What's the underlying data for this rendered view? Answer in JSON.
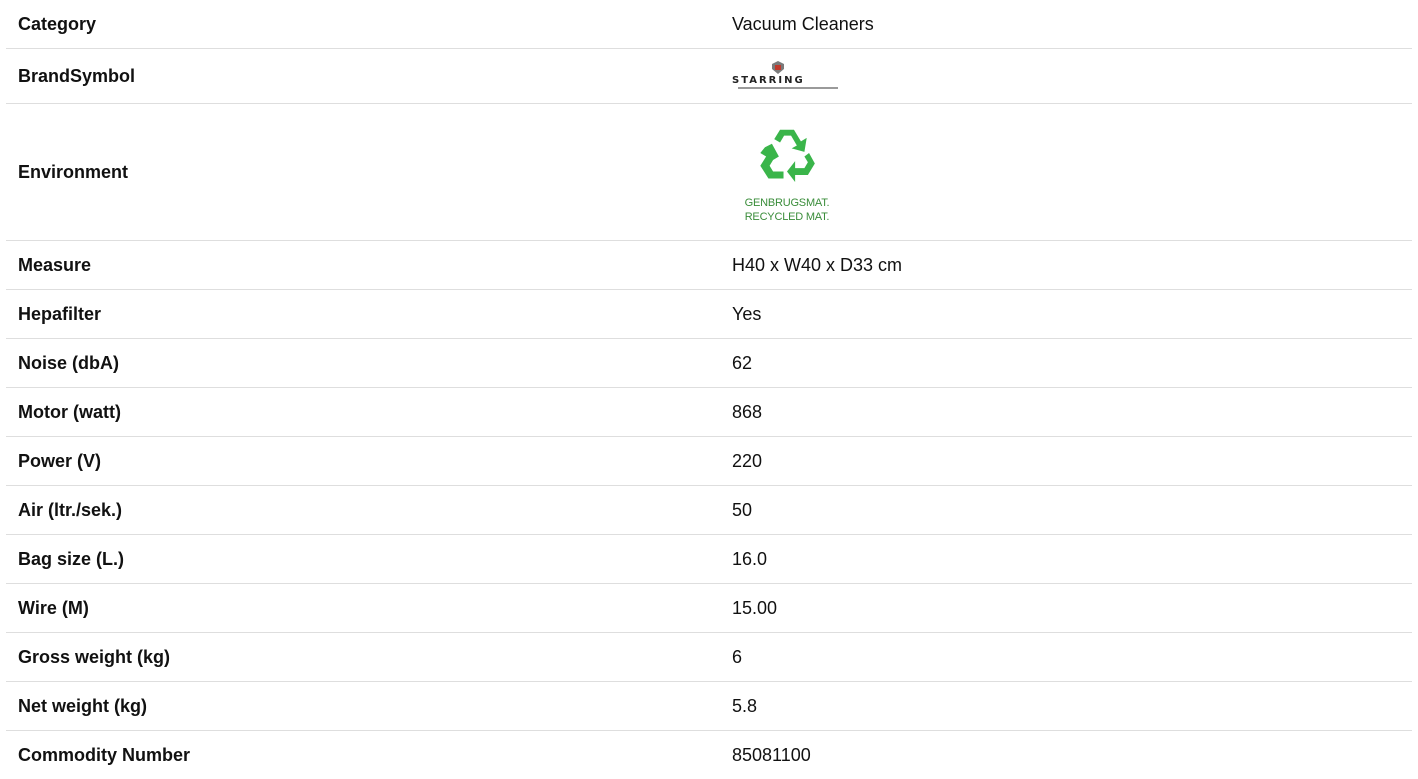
{
  "colors": {
    "recycle_green": "#3ab54a",
    "env_text": "#3a8d3a",
    "row_divider": "#dedede"
  },
  "rows": [
    {
      "label": "Category",
      "value": "Vacuum Cleaners"
    },
    {
      "label": "BrandSymbol",
      "logo_text": "STARRING",
      "icon": "brand-logo"
    },
    {
      "label": "Environment",
      "icon": "recycle-icon",
      "lines": [
        "GENBRUGSMAT.",
        "RECYCLED MAT."
      ]
    },
    {
      "label": "Measure",
      "value": "H40 x W40 x D33 cm"
    },
    {
      "label": "Hepafilter",
      "value": "Yes"
    },
    {
      "label": "Noise (dbA)",
      "value": "62"
    },
    {
      "label": "Motor (watt)",
      "value": "868"
    },
    {
      "label": "Power (V)",
      "value": "220"
    },
    {
      "label": "Air (ltr./sek.)",
      "value": "50"
    },
    {
      "label": "Bag size (L.)",
      "value": "16.0"
    },
    {
      "label": "Wire (M)",
      "value": "15.00"
    },
    {
      "label": "Gross weight (kg)",
      "value": "6"
    },
    {
      "label": "Net weight (kg)",
      "value": "5.8"
    },
    {
      "label": "Commodity Number",
      "value": "85081100"
    }
  ]
}
